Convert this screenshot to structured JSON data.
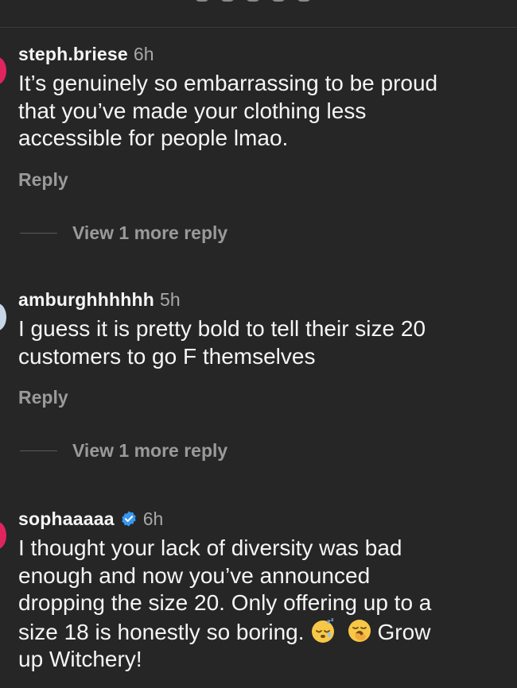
{
  "comments": [
    {
      "username": "steph.briese",
      "time": "6h",
      "text": "It’s genuinely so embarrassing to be proud\nthat you’ve made your clothing less\naccessible for people lmao.",
      "reply_label": "Reply",
      "view_more": "View 1 more reply",
      "avatar_color": "#e0245e"
    },
    {
      "username": "amburghhhhhh",
      "time": "5h",
      "text": "I guess it is pretty bold to tell their size 20\ncustomers to go F themselves",
      "reply_label": "Reply",
      "view_more": "View 1 more reply",
      "avatar_color": "#c7d7e8"
    },
    {
      "username": "sophaaaaa",
      "time": "6h",
      "verified": true,
      "text_lines": [
        "I thought your lack of diversity was bad",
        "enough and now you’ve announced",
        "dropping the size 20. Only offering up to a",
        "size 18 is honestly so boring."
      ],
      "text_after_emojis": "Grow",
      "text_last_line": "up Witchery!",
      "emojis": [
        "sleeping-face-emoji",
        "yawning-face-emoji"
      ],
      "avatar_color": "#e0245e"
    }
  ],
  "colors": {
    "background": "#262626",
    "primary_text": "#f5f5f5",
    "secondary_text": "#a8a8a8",
    "reply_text": "#9a9a9a",
    "verified_blue": "#3897f0"
  }
}
